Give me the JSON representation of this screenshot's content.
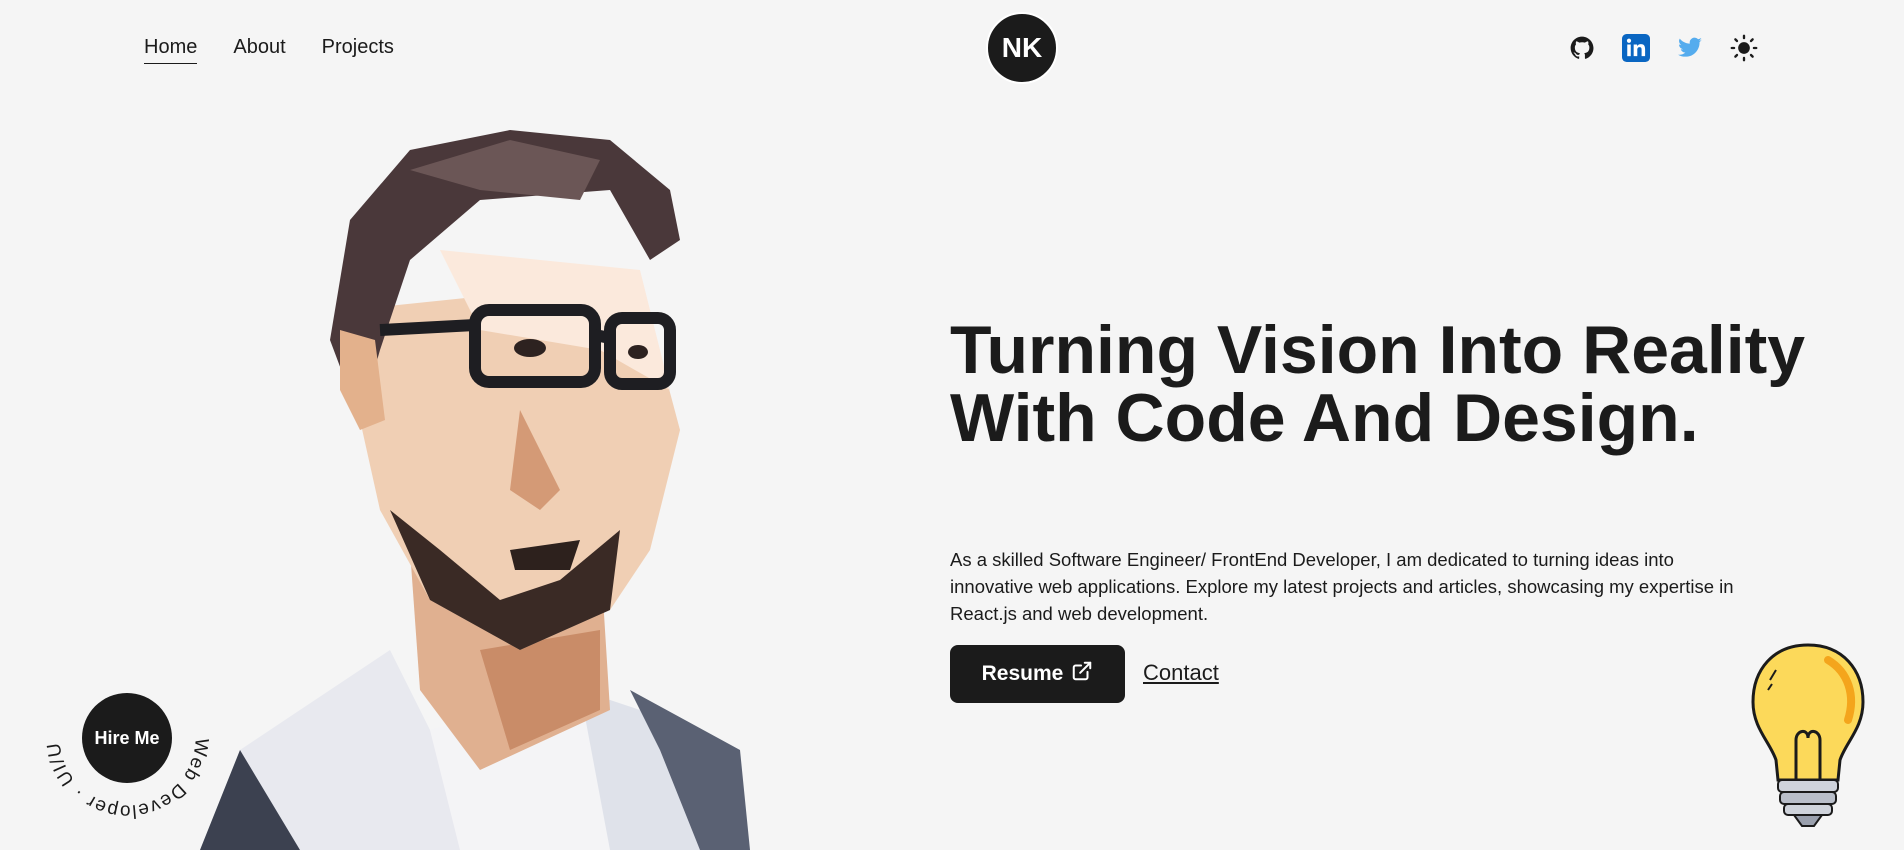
{
  "nav": {
    "items": [
      "Home",
      "About",
      "Projects"
    ],
    "active": "Home"
  },
  "logo": {
    "text": "NK"
  },
  "socials": {
    "icons": [
      "github-icon",
      "linkedin-icon",
      "twitter-icon",
      "theme-toggle-sun-icon"
    ],
    "linkedin_color": "#0a66c2",
    "twitter_color": "#55acee"
  },
  "hero": {
    "title": "Turning Vision Into Reality With Code And Design.",
    "description": "As a skilled Software Engineer/ FrontEnd Developer, I am dedicated to turning ideas into innovative web applications. Explore my latest projects and articles, showcasing my expertise in React.js and web development.",
    "resume_label": "Resume",
    "contact_label": "Contact"
  },
  "hire": {
    "button_label": "Hire Me",
    "ring_text": "Web Developer · UI/UX Designer · "
  },
  "colors": {
    "background": "#f5f5f5",
    "dark": "#1b1b1b",
    "bulb": "#fcd95a"
  }
}
